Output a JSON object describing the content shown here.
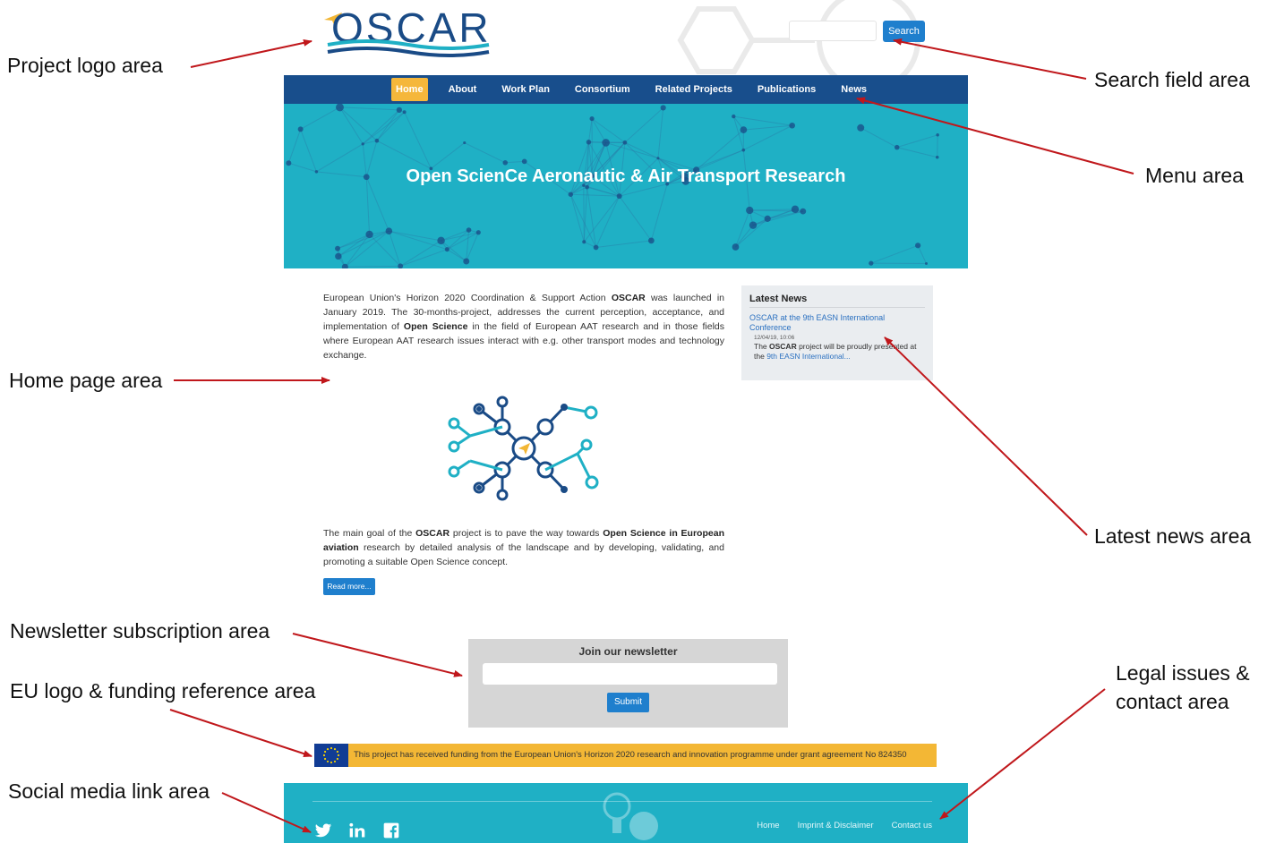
{
  "logo": {
    "text": "OSCAR"
  },
  "search": {
    "placeholder": "",
    "button_label": "Search"
  },
  "nav": {
    "items": [
      "Home",
      "About",
      "Work Plan",
      "Consortium",
      "Related Projects",
      "Publications",
      "News"
    ],
    "active": "Home"
  },
  "hero": {
    "title": "Open ScienCe Aeronautic & Air Transport Research"
  },
  "main": {
    "intro_parts": [
      "European Union's Horizon 2020 Coordination & Support Action ",
      "OSCAR",
      " was launched in January 2019. The 30-months-project, addresses the current perception, acceptance, and implementation of ",
      "Open Science",
      " in the field of European AAT research and in those fields where European AAT research issues interact with e.g. other transport modes and technology exchange."
    ],
    "goal_parts": [
      "The main goal of the ",
      "OSCAR",
      " project is to pave the way towards ",
      "Open Science in European aviation",
      " research by detailed analysis of the landscape and by developing, validating, and promoting a suitable Open Science concept."
    ],
    "read_more": "Read more..."
  },
  "latest_news": {
    "title": "Latest News",
    "link": "OSCAR at the 9th EASN International Conference",
    "date": "12/04/19, 10:06",
    "excerpt_parts": [
      "The ",
      "OSCAR",
      " project will be proudly presented at the ",
      "9th EASN International..."
    ]
  },
  "newsletter": {
    "title": "Join our newsletter",
    "submit": "Submit",
    "placeholder": ""
  },
  "funding": {
    "text": "This project has received funding from the European Union's Horizon 2020 research and innovation programme under grant agreement No 824350"
  },
  "footer": {
    "social": [
      "twitter-icon",
      "linkedin-icon",
      "facebook-icon"
    ],
    "links": [
      "Home",
      "Imprint & Disclaimer",
      "Contact us"
    ]
  },
  "callouts": {
    "logo": "Project logo area",
    "search": "Search field area",
    "menu": "Menu area",
    "home": "Home page area",
    "news": "Latest news area",
    "newsletter": "Newsletter subscription area",
    "eu": "EU logo &  funding reference area",
    "social": "Social media link area",
    "legal_1": "Legal issues &",
    "legal_2": "contact area"
  },
  "colors": {
    "brand_blue": "#184e8c",
    "teal": "#1fb0c5",
    "accent": "#f5b73b",
    "button": "#1f7fcd",
    "arrow": "#c0171b"
  }
}
